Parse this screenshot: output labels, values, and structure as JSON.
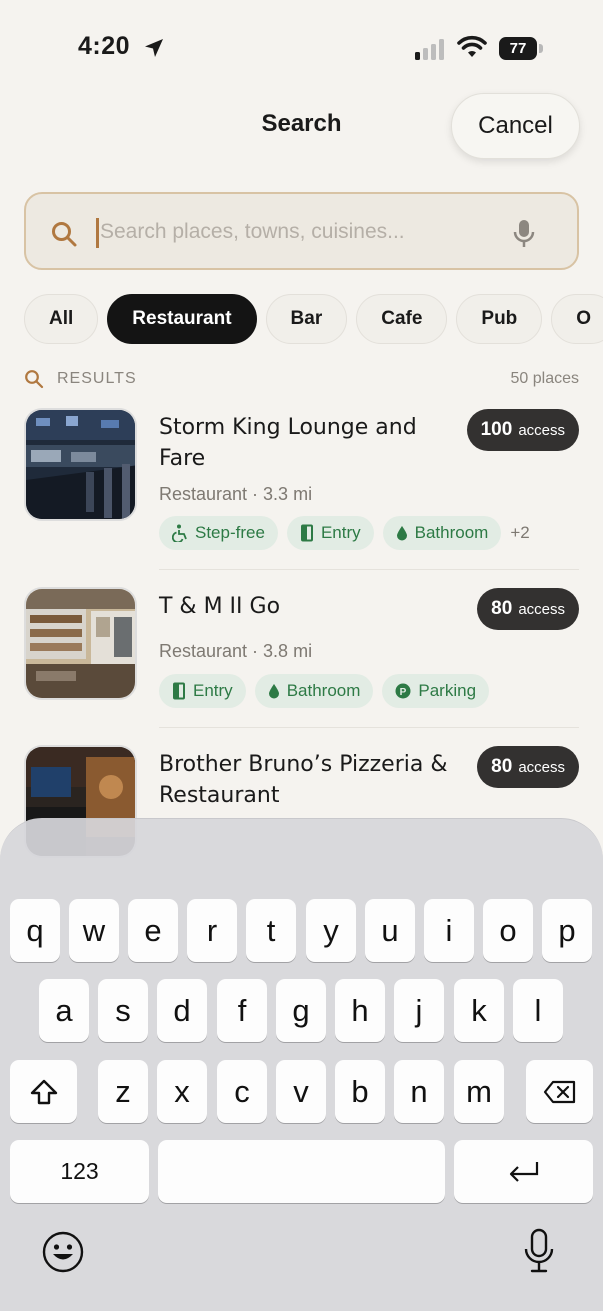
{
  "status_bar": {
    "time": "4:20",
    "battery": "77"
  },
  "header": {
    "title": "Search",
    "cancel_label": "Cancel"
  },
  "search": {
    "placeholder": "Search places, towns, cuisines..."
  },
  "filters": [
    "All",
    "Restaurant",
    "Bar",
    "Cafe",
    "Pub",
    "O"
  ],
  "active_filter": "Restaurant",
  "results_header": {
    "label": "RESULTS",
    "count": "50 places"
  },
  "results": [
    {
      "name": "Storm King Lounge and Fare",
      "meta": "Restaurant · 3.3 mi",
      "score": "100",
      "score_label": "access",
      "tags": [
        "Step-free",
        "Entry",
        "Bathroom"
      ],
      "more": "+2"
    },
    {
      "name": "T & M II Go",
      "meta": "Restaurant · 3.8 mi",
      "score": "80",
      "score_label": "access",
      "tags": [
        "Entry",
        "Bathroom",
        "Parking"
      ]
    },
    {
      "name": "Brother Bruno’s Pizzeria & Restaurant",
      "score": "80",
      "score_label": "access"
    }
  ],
  "keyboard": {
    "row1": [
      "q",
      "w",
      "e",
      "r",
      "t",
      "y",
      "u",
      "i",
      "o",
      "p"
    ],
    "row2": [
      "a",
      "s",
      "d",
      "f",
      "g",
      "h",
      "j",
      "k",
      "l"
    ],
    "row3": [
      "z",
      "x",
      "c",
      "v",
      "b",
      "n",
      "m"
    ],
    "numbers_key": "123"
  },
  "colors": {
    "background": "#f5f3ef",
    "accent": "#b07840",
    "tag_green": "#2d7a45",
    "dark": "#141414"
  }
}
